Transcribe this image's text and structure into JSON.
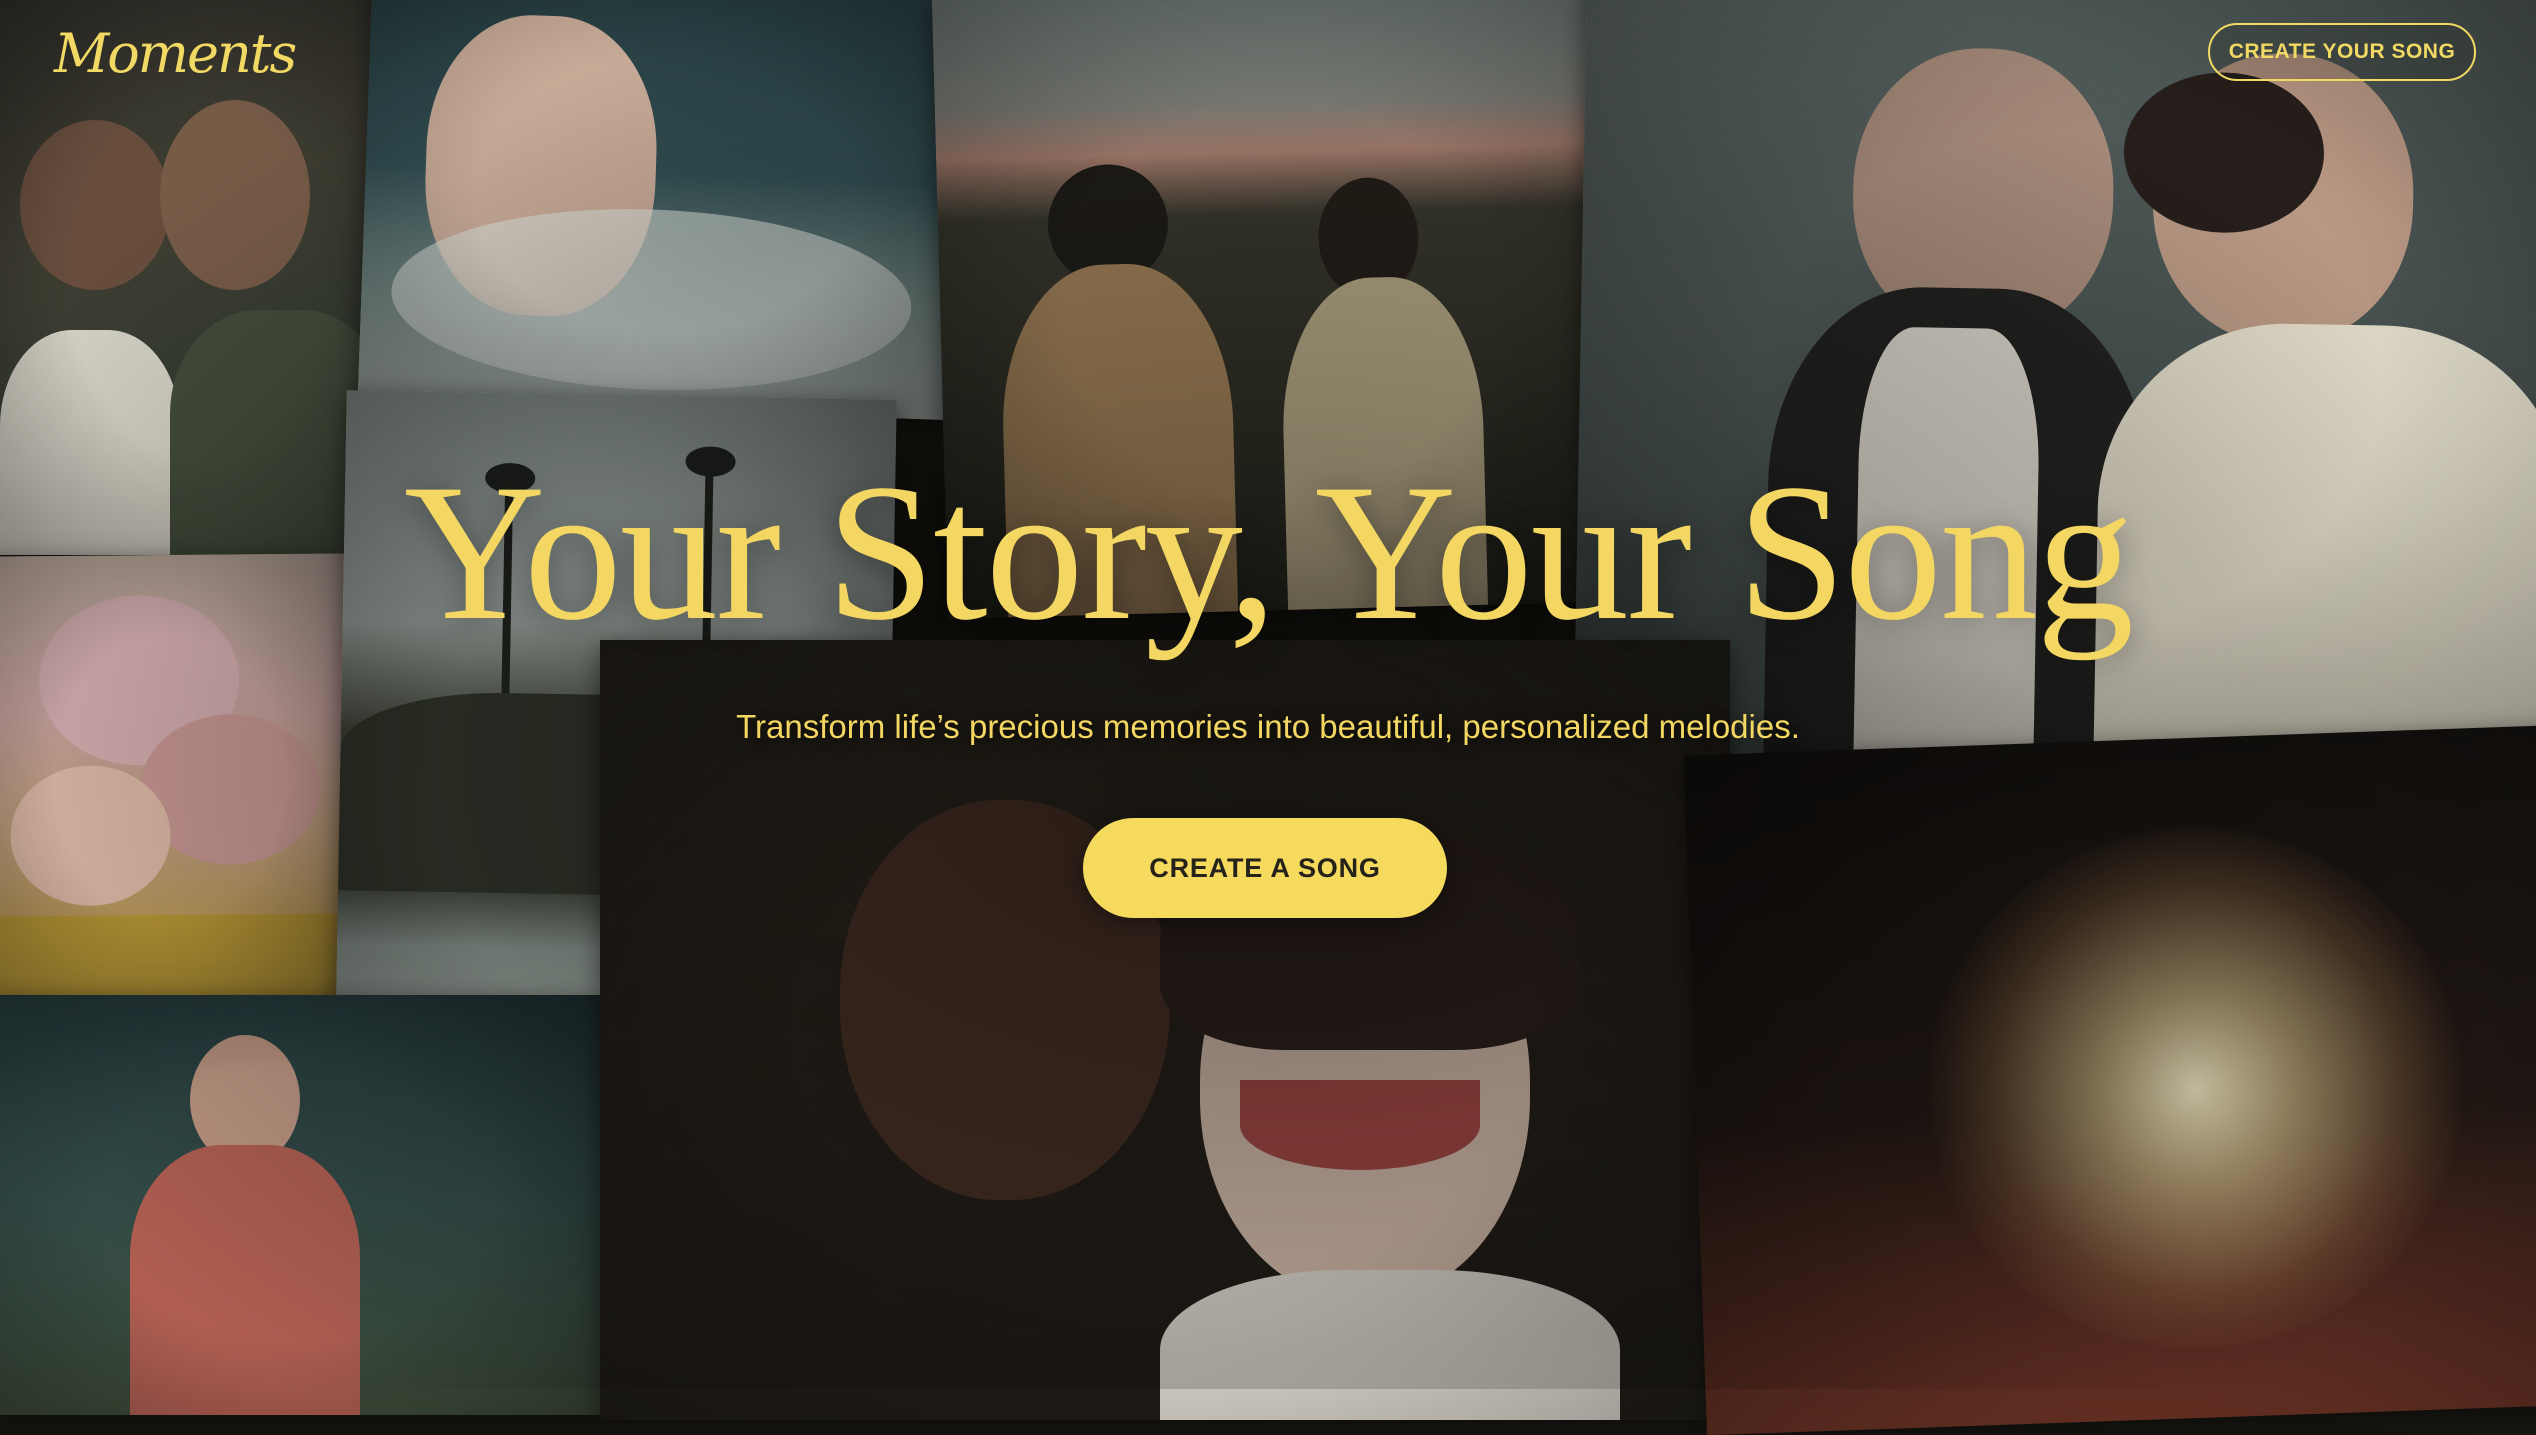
{
  "header": {
    "logo": "Moments",
    "cta_label": "CREATE YOUR SONG"
  },
  "hero": {
    "title": "Your Story, Your Song",
    "subtitle": "Transform life’s precious memories into beautiful, personalized melodies.",
    "cta_label": "CREATE A SONG"
  },
  "colors": {
    "accent": "#f3d762",
    "button_text": "#25221a",
    "background": "#15140f"
  },
  "background_photos": [
    "couple-embracing-photo",
    "child-splashing-water-photo",
    "couple-at-sunset-photo",
    "older-couple-smiling-photo",
    "pink-flowers-photo",
    "coastal-cliff-palm-trees-photo",
    "woman-dancing-red-dress-photo",
    "friends-laughing-photo",
    "fireworks-photo"
  ]
}
